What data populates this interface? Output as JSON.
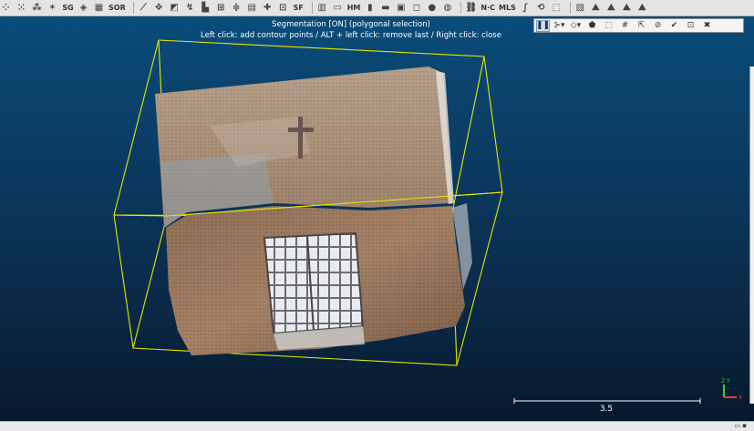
{
  "toolbar": {
    "items": [
      {
        "icon": "subsample-icon",
        "glyph": "⁘"
      },
      {
        "icon": "resample-icon",
        "glyph": "⁙"
      },
      {
        "icon": "noise-filter-icon",
        "glyph": "⁂"
      },
      {
        "icon": "clean-icon",
        "glyph": "✶"
      },
      {
        "icon": "sor-small-icon",
        "glyph": "SG",
        "text": true
      },
      {
        "icon": "fill-icon",
        "glyph": "◈"
      },
      {
        "icon": "grid-icon",
        "glyph": "▦"
      },
      {
        "icon": "sor-icon",
        "glyph": "SOR",
        "text": true
      },
      {
        "icon": "measure-icon",
        "glyph": "⟋"
      },
      {
        "icon": "move-icon",
        "glyph": "✥"
      },
      {
        "icon": "mesh-icon",
        "glyph": "◩"
      },
      {
        "icon": "plane-icon",
        "glyph": "↯"
      },
      {
        "icon": "histogram-icon",
        "glyph": "▙"
      },
      {
        "icon": "cloud-compare-icon",
        "glyph": "⊞"
      },
      {
        "icon": "align-icon",
        "glyph": "≑"
      },
      {
        "icon": "layers-icon",
        "glyph": "▤"
      },
      {
        "icon": "add-icon",
        "glyph": "✚"
      },
      {
        "icon": "sampling-icon",
        "glyph": "⊡"
      },
      {
        "icon": "sf-icon",
        "glyph": "SF",
        "text": true
      },
      {
        "icon": "table-icon",
        "glyph": "▥"
      },
      {
        "icon": "filter-icon",
        "glyph": "▭"
      },
      {
        "icon": "hm-icon",
        "glyph": "HM",
        "text": true
      },
      {
        "icon": "bar-chart-icon",
        "glyph": "▮"
      },
      {
        "icon": "delete-icon",
        "glyph": "▬"
      },
      {
        "icon": "box-icon",
        "glyph": "▣"
      },
      {
        "icon": "square-icon",
        "glyph": "◻"
      },
      {
        "icon": "sphere-icon",
        "glyph": "●"
      },
      {
        "icon": "globe-icon",
        "glyph": "◍"
      },
      {
        "icon": "link-icon",
        "glyph": "⛓"
      },
      {
        "icon": "m3c2-icon",
        "glyph": "N·C",
        "text": true
      },
      {
        "icon": "mls-icon",
        "glyph": "MLS",
        "text": true
      },
      {
        "icon": "wave-icon",
        "glyph": "∫"
      },
      {
        "icon": "rotate-icon",
        "glyph": "⟲"
      },
      {
        "icon": "segment-icon",
        "glyph": "⬚"
      },
      {
        "icon": "colors-icon",
        "glyph": "▧"
      },
      {
        "icon": "mountain-1-icon",
        "glyph": "⛰"
      },
      {
        "icon": "mountain-2-icon",
        "glyph": "⛰"
      },
      {
        "icon": "mountain-3-icon",
        "glyph": "⛰"
      },
      {
        "icon": "mountain-4-icon",
        "glyph": "⛰"
      }
    ]
  },
  "segmentation": {
    "title": "Segmentation [ON] (polygonal selection)",
    "instructions": "Left click: add contour points / ALT + left click: remove last / Right click: close",
    "buttons": [
      {
        "icon": "pause-icon",
        "glyph": "❚❚",
        "active": true
      },
      {
        "icon": "polyline-selection-icon",
        "glyph": "⊱▾"
      },
      {
        "icon": "polygon-dropdown-icon",
        "glyph": "◇▾"
      },
      {
        "icon": "segment-in-icon",
        "glyph": "⬟"
      },
      {
        "icon": "segment-out-icon",
        "glyph": "⬚"
      },
      {
        "icon": "export-icon",
        "glyph": "#"
      },
      {
        "icon": "export-section-icon",
        "glyph": "⇱"
      },
      {
        "icon": "reset-icon",
        "glyph": "⊘"
      },
      {
        "icon": "confirm-icon",
        "glyph": "✔"
      },
      {
        "icon": "confirm-delete-icon",
        "glyph": "⊡"
      },
      {
        "icon": "cancel-icon",
        "glyph": "✖"
      }
    ]
  },
  "scale": {
    "label": "3.5"
  },
  "colors": {
    "bbox": "#e6e600",
    "axis_z": "#3cd13c",
    "axis_x": "#e23c3c"
  }
}
